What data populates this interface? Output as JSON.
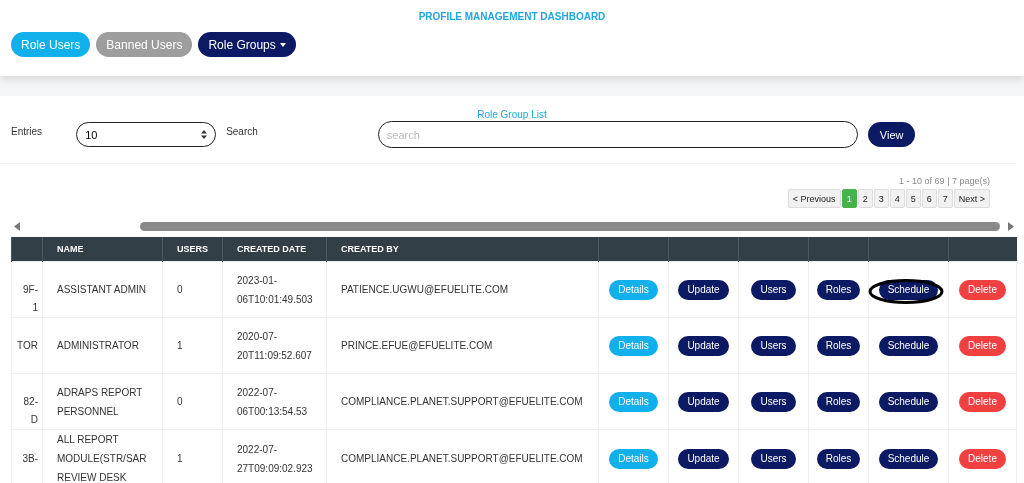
{
  "header": {
    "title": "PROFILE MANAGEMENT DASHBOARD",
    "nav": [
      {
        "label": "Role Users",
        "kind": "primary",
        "dropdown": false
      },
      {
        "label": "Banned Users",
        "kind": "muted",
        "dropdown": false
      },
      {
        "label": "Role Groups",
        "kind": "dark",
        "dropdown": true
      }
    ]
  },
  "list_title": "Role Group List",
  "controls": {
    "entries_label": "Entries",
    "entries_value": "10",
    "search_label": "Search",
    "search_placeholder": "search",
    "view_button": "View"
  },
  "pagination": {
    "summary": "1 - 10 of 69 | 7 page(s)",
    "previous": "< Previous",
    "next": "Next >",
    "pages": [
      {
        "label": "1",
        "selected": true
      },
      {
        "label": "2",
        "selected": false
      },
      {
        "label": "3",
        "selected": false
      },
      {
        "label": "4",
        "selected": false
      },
      {
        "label": "5",
        "selected": false
      },
      {
        "label": "6",
        "selected": false
      },
      {
        "label": "7",
        "selected": false
      }
    ]
  },
  "table": {
    "columns": [
      "",
      "NAME",
      "USERS",
      "CREATED DATE",
      "CREATED BY"
    ],
    "rows": [
      {
        "column_1": [
          "9F-",
          "1"
        ],
        "name": "ASSISTANT ADMIN",
        "users": "0",
        "created_date": "2023-01-06T10:01:49.503",
        "created_by": "PATIENCE.UGWU@EFUELITE.COM",
        "actions": [
          {
            "label": "Details",
            "kind": "info",
            "circled": false
          },
          {
            "label": "Update",
            "kind": "dark",
            "circled": false
          },
          {
            "label": "Users",
            "kind": "dark",
            "circled": false
          },
          {
            "label": "Roles",
            "kind": "dark",
            "circled": false
          },
          {
            "label": "Schedule",
            "kind": "dark",
            "circled": true
          },
          {
            "label": "Delete",
            "kind": "danger",
            "circled": false
          }
        ]
      },
      {
        "column_1": [
          "TOR"
        ],
        "name": "ADMINISTRATOR",
        "users": "1",
        "created_date": "2020-07-20T11:09:52.607",
        "created_by": "PRINCE.EFUE@EFUELITE.COM",
        "actions": [
          {
            "label": "Details",
            "kind": "info",
            "circled": false
          },
          {
            "label": "Update",
            "kind": "dark",
            "circled": false
          },
          {
            "label": "Users",
            "kind": "dark",
            "circled": false
          },
          {
            "label": "Roles",
            "kind": "dark",
            "circled": false
          },
          {
            "label": "Schedule",
            "kind": "dark",
            "circled": false
          },
          {
            "label": "Delete",
            "kind": "danger",
            "circled": false
          }
        ]
      },
      {
        "column_1": [
          "82-",
          "D"
        ],
        "name": "ADRAPS REPORT PERSONNEL",
        "users": "0",
        "created_date": "2022-07-06T00:13:54.53",
        "created_by": "COMPLIANCE.PLANET.SUPPORT@EFUELITE.COM",
        "actions": [
          {
            "label": "Details",
            "kind": "info",
            "circled": false
          },
          {
            "label": "Update",
            "kind": "dark",
            "circled": false
          },
          {
            "label": "Users",
            "kind": "dark",
            "circled": false
          },
          {
            "label": "Roles",
            "kind": "dark",
            "circled": false
          },
          {
            "label": "Schedule",
            "kind": "dark",
            "circled": false
          },
          {
            "label": "Delete",
            "kind": "danger",
            "circled": false
          }
        ]
      },
      {
        "column_1": [
          "3B-"
        ],
        "name": "ALL REPORT MODULE(STR/SAR REVIEW DESK",
        "users": "1",
        "created_date": "2022-07-27T09:09:02.923",
        "created_by": "COMPLIANCE.PLANET.SUPPORT@EFUELITE.COM",
        "actions": [
          {
            "label": "Details",
            "kind": "info",
            "circled": false
          },
          {
            "label": "Update",
            "kind": "dark",
            "circled": false
          },
          {
            "label": "Users",
            "kind": "dark",
            "circled": false
          },
          {
            "label": "Roles",
            "kind": "dark",
            "circled": false
          },
          {
            "label": "Schedule",
            "kind": "dark",
            "circled": false
          },
          {
            "label": "Delete",
            "kind": "danger",
            "circled": false
          }
        ]
      }
    ]
  }
}
